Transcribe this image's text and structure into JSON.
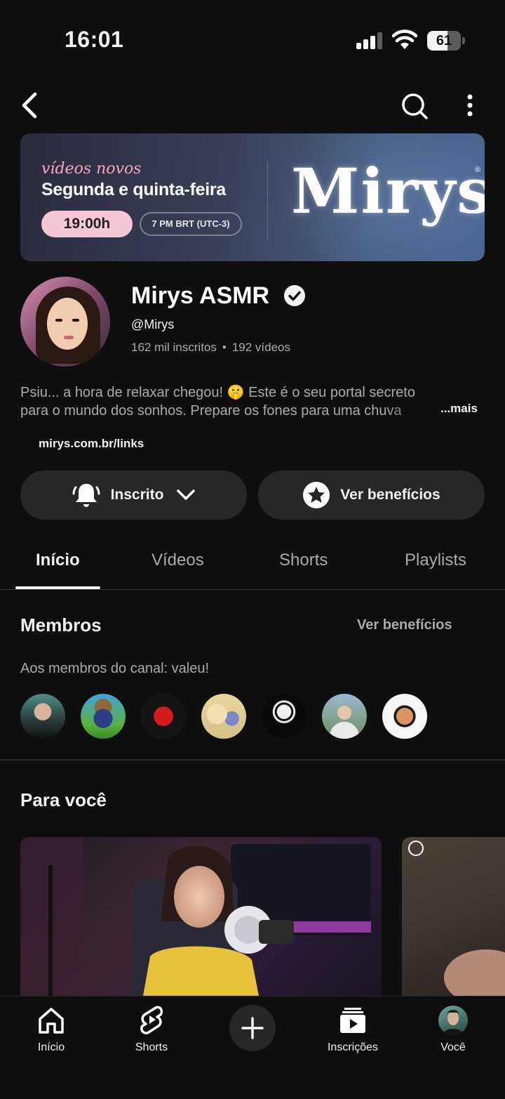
{
  "status_bar": {
    "time": "16:01",
    "battery": "61",
    "battery_level": 0.61
  },
  "banner": {
    "script_text": "vídeos novos",
    "days": "Segunda e quinta-feira",
    "time_badge": "19:00h",
    "zone_badge": "7 PM BRT (UTC-3)",
    "logo": "Mirys",
    "registered": "®"
  },
  "channel": {
    "name": "Mirys ASMR",
    "handle": "@Mirys",
    "subscribers": "162 mil inscritos",
    "separator": "•",
    "videos": "192 vídeos",
    "description_line1": "Psiu... a hora de relaxar chegou! 🤫 Este é o seu portal secreto",
    "description_line2": "para o mundo dos sonhos. Prepare os fones para uma chuva",
    "more": "...mais",
    "link": "mirys.com.br/links"
  },
  "actions": {
    "subscribed_label": "Inscrito",
    "benefits_label": "Ver benefícios"
  },
  "tabs": [
    {
      "label": "Início",
      "active": true
    },
    {
      "label": "Vídeos",
      "active": false
    },
    {
      "label": "Shorts",
      "active": false
    },
    {
      "label": "Playlists",
      "active": false
    }
  ],
  "members": {
    "title": "Membros",
    "link": "Ver benefícios",
    "subtitle": "Aos membros do canal: valeu!",
    "avatars": [
      "member-1",
      "member-2",
      "member-3",
      "member-4",
      "member-5",
      "member-6",
      "member-7"
    ]
  },
  "for_you": {
    "title": "Para você"
  },
  "bottom_nav": {
    "home": "Início",
    "shorts": "Shorts",
    "subscriptions": "Inscrições",
    "you": "Você"
  },
  "colors": {
    "background": "#0f0f0f",
    "pill": "#272727",
    "muted_text": "#aaaaaa"
  }
}
